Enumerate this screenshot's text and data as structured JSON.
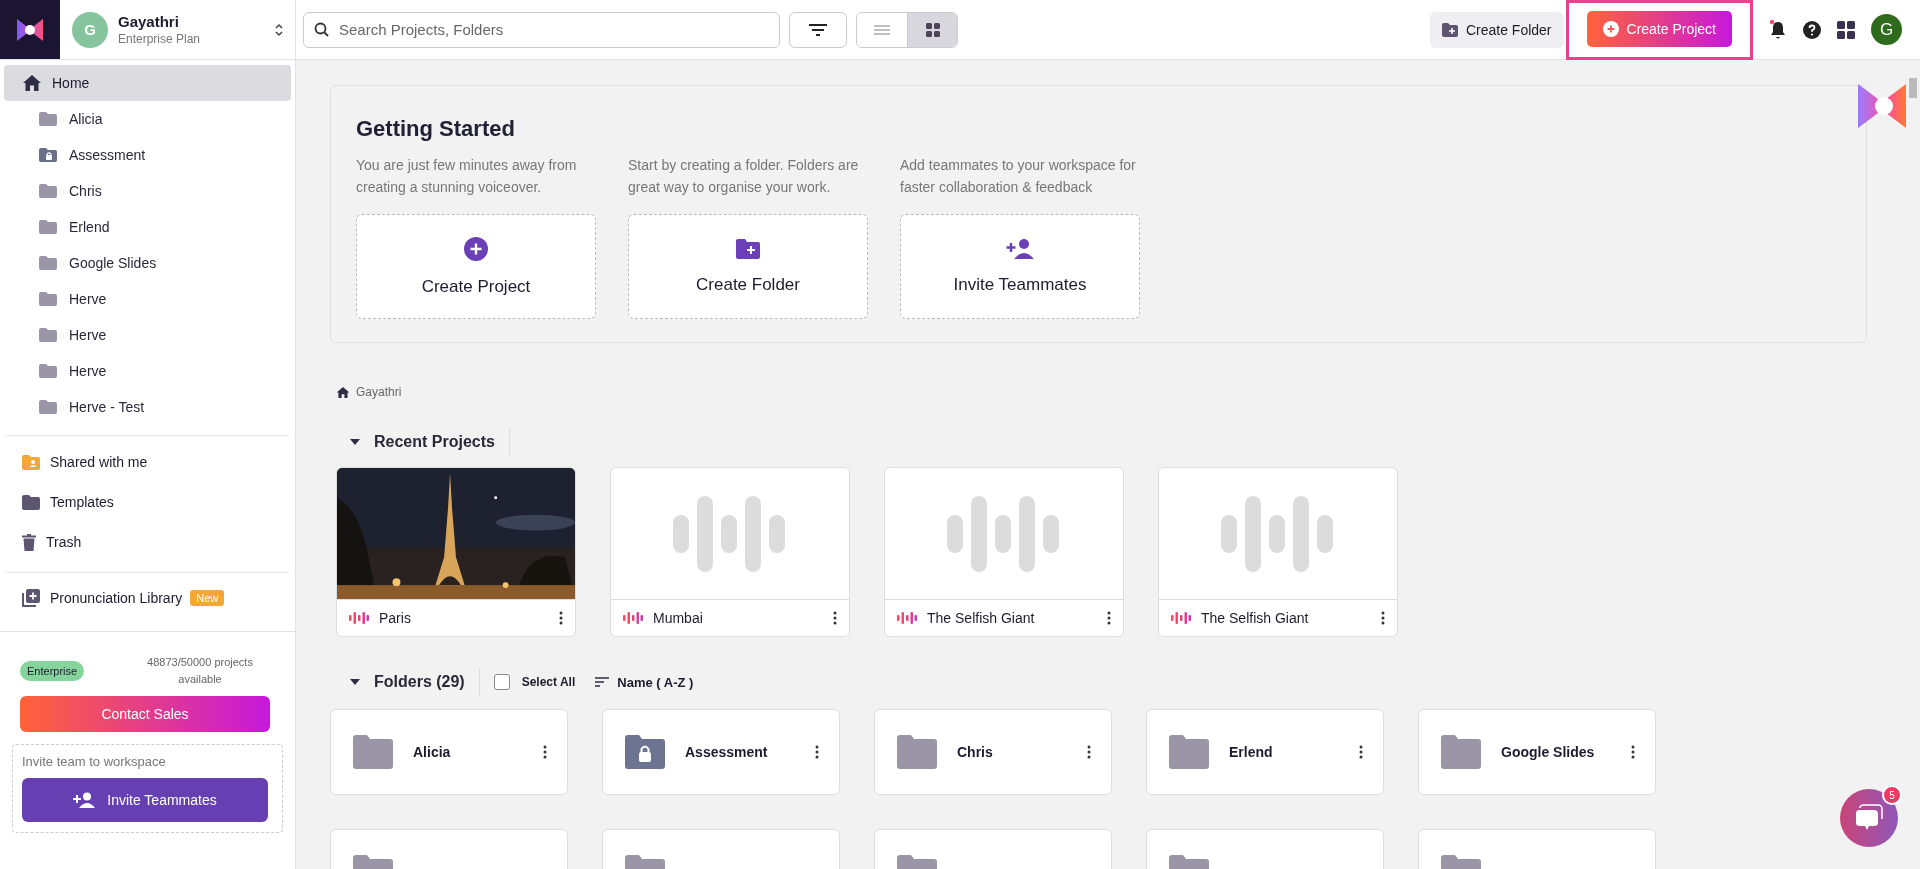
{
  "workspace": {
    "avatar": "G",
    "name": "Gayathri",
    "plan": "Enterprise Plan"
  },
  "search": {
    "placeholder": "Search Projects, Folders"
  },
  "view_toggle": [
    {
      "kind": "list",
      "selected": false
    },
    {
      "kind": "grid",
      "selected": true
    }
  ],
  "header_actions": {
    "create_folder": "Create Folder",
    "create_project": "Create Project",
    "highlighted": true,
    "notifications_unread": true,
    "user_avatar": "G"
  },
  "sidebar": {
    "home": {
      "label": "Home",
      "selected": true
    },
    "folders": [
      {
        "label": "Alicia",
        "kind": "folder"
      },
      {
        "label": "Assessment",
        "kind": "locked"
      },
      {
        "label": "Chris",
        "kind": "folder"
      },
      {
        "label": "Erlend",
        "kind": "folder"
      },
      {
        "label": "Google Slides",
        "kind": "folder"
      },
      {
        "label": "Herve",
        "kind": "folder"
      },
      {
        "label": "Herve",
        "kind": "folder"
      },
      {
        "label": "Herve",
        "kind": "folder"
      },
      {
        "label": "Herve - Test",
        "kind": "folder"
      }
    ],
    "links": [
      {
        "label": "Shared with me",
        "kind": "shared"
      },
      {
        "label": "Templates",
        "kind": "templates"
      },
      {
        "label": "Trash",
        "kind": "trash"
      }
    ],
    "library": {
      "label": "Pronunciation Library",
      "badge": "New"
    },
    "plan": {
      "badge": "Enterprise",
      "usage": "48873/50000 projects available",
      "button": "Contact Sales"
    },
    "invite": {
      "label": "Invite team to workspace",
      "button": "Invite Teammates"
    }
  },
  "getting_started": {
    "title": "Getting Started",
    "cards": [
      {
        "kind": "project",
        "description": "You are just few minutes away from creating a stunning voiceover.",
        "label": "Create Project"
      },
      {
        "kind": "folder",
        "description": "Start by creating a folder. Folders are great way to organise your work.",
        "label": "Create Folder"
      },
      {
        "kind": "invite",
        "description": "Add teammates to your workspace for faster collaboration & feedback",
        "label": "Invite Teammates"
      }
    ]
  },
  "breadcrumb": "Gayathri",
  "recent_projects": {
    "title": "Recent Projects",
    "expanded": true,
    "items": [
      {
        "name": "Paris",
        "kind": "picture"
      },
      {
        "name": "Mumbai",
        "kind": "placeholder"
      },
      {
        "name": "The Selfish Giant",
        "kind": "placeholder"
      },
      {
        "name": "The Selfish Giant",
        "kind": "placeholder"
      }
    ]
  },
  "folders": {
    "title": "Folders (29)",
    "expanded": true,
    "select_all": {
      "label": "Select All",
      "checked": false
    },
    "sort": "Name ( A-Z )",
    "items": [
      {
        "name": "Alicia",
        "kind": "folder"
      },
      {
        "name": "Assessment",
        "kind": "locked"
      },
      {
        "name": "Chris",
        "kind": "folder"
      },
      {
        "name": "Erlend",
        "kind": "folder"
      },
      {
        "name": "Google Slides",
        "kind": "folder"
      }
    ]
  },
  "chat": {
    "badge": "5"
  }
}
